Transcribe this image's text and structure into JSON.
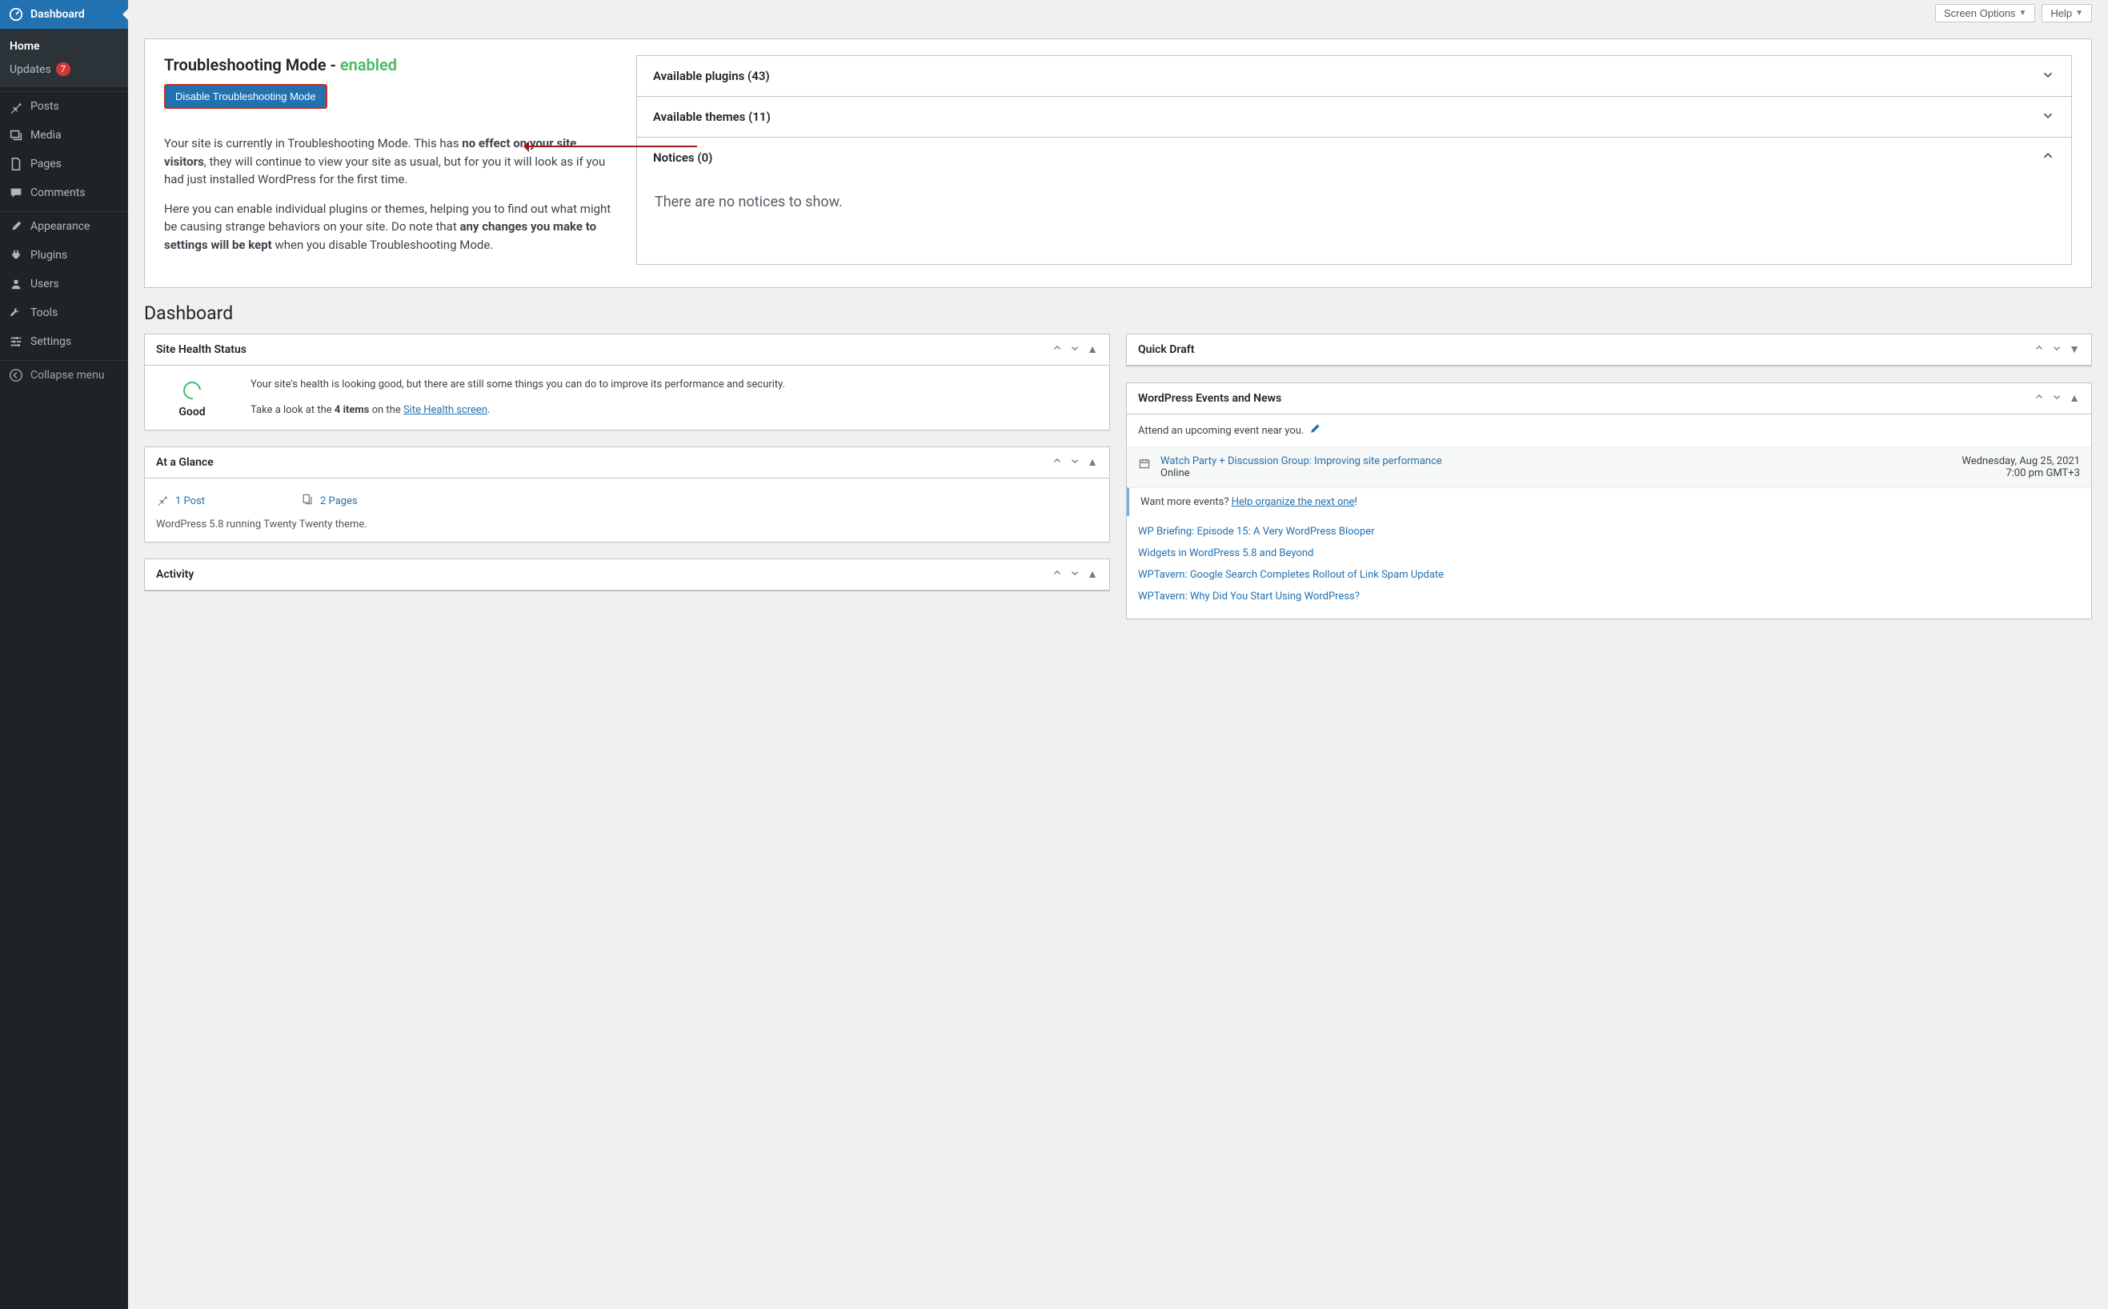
{
  "topbar": {
    "screen_options": "Screen Options",
    "help": "Help"
  },
  "sidebar": {
    "dashboard": "Dashboard",
    "home": "Home",
    "updates": "Updates",
    "updates_count": "7",
    "posts": "Posts",
    "media": "Media",
    "pages": "Pages",
    "comments": "Comments",
    "appearance": "Appearance",
    "plugins": "Plugins",
    "users": "Users",
    "tools": "Tools",
    "settings": "Settings",
    "collapse": "Collapse menu"
  },
  "troubleshoot": {
    "title_prefix": "Troubleshooting Mode - ",
    "enabled_label": "enabled",
    "disable_btn": "Disable Troubleshooting Mode",
    "p1a": "Your site is currently in Troubleshooting Mode. This has ",
    "p1b": "no effect on your site visitors",
    "p1c": ", they will continue to view your site as usual, but for you it will look as if you had just installed WordPress for the first time.",
    "p2a": "Here you can enable individual plugins or themes, helping you to find out what might be causing strange behaviors on your site. Do note that ",
    "p2b": "any changes you make to settings will be kept",
    "p2c": " when you disable Troubleshooting Mode.",
    "acc_plugins": "Available plugins (43)",
    "acc_themes": "Available themes (11)",
    "acc_notices": "Notices (0)",
    "acc_notices_body": "There are no notices to show."
  },
  "page_title": "Dashboard",
  "health": {
    "title": "Site Health Status",
    "gauge_label": "Good",
    "line1": "Your site's health is looking good, but there are still some things you can do to improve its performance and security.",
    "line2a": "Take a look at the ",
    "line2b": "4 items",
    "line2c": " on the ",
    "line2d": "Site Health screen",
    "line2e": "."
  },
  "glance": {
    "title": "At a Glance",
    "posts": "1 Post",
    "pages": "2 Pages",
    "version_line": "WordPress 5.8 running Twenty Twenty theme."
  },
  "activity": {
    "title": "Activity"
  },
  "quickdraft": {
    "title": "Quick Draft"
  },
  "events": {
    "title": "WordPress Events and News",
    "attend": "Attend an upcoming event near you.",
    "event_title": "Watch Party + Discussion Group: Improving site performance",
    "event_loc": "Online",
    "event_date": "Wednesday, Aug 25, 2021",
    "event_time": "7:00 pm GMT+3",
    "want_more_a": "Want more events? ",
    "want_more_link": "Help organize the next one",
    "want_more_c": "!",
    "news": [
      "WP Briefing: Episode 15: A Very WordPress Blooper",
      "Widgets in WordPress 5.8 and Beyond",
      "WPTavern: Google Search Completes Rollout of Link Spam Update",
      "WPTavern: Why Did You Start Using WordPress?"
    ]
  }
}
